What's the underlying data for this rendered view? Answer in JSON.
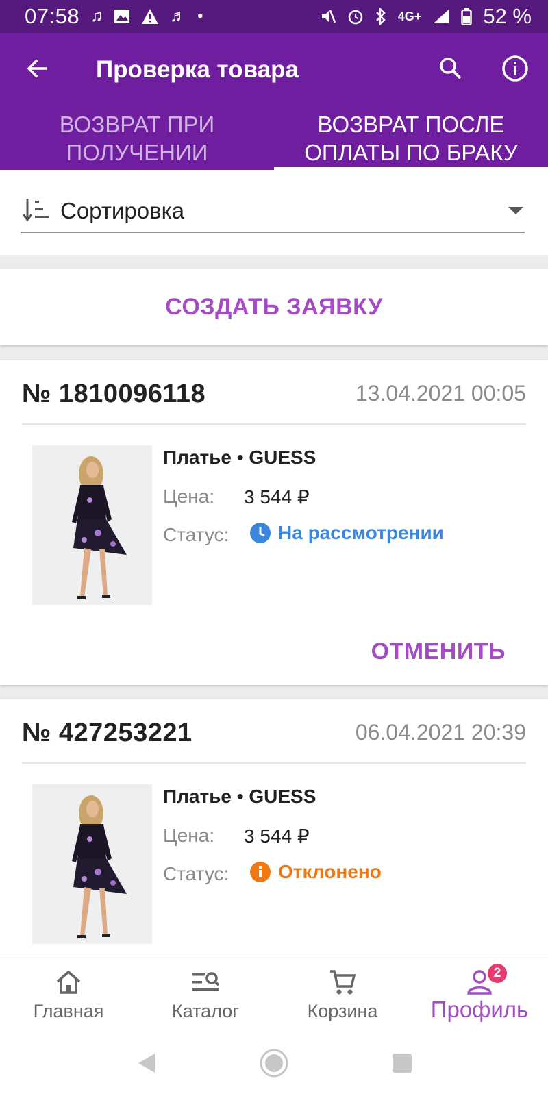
{
  "status_bar": {
    "time": "07:58",
    "network": "4G+",
    "battery": "52 %"
  },
  "toolbar": {
    "title": "Проверка товара",
    "back_icon": "arrow-left-icon",
    "search_icon": "search-icon",
    "info_icon": "info-icon"
  },
  "tabs": [
    {
      "label": "Возврат при получении",
      "active": false
    },
    {
      "label": "Возврат после оплаты по браку",
      "active": true
    }
  ],
  "sort": {
    "label": "Сортировка",
    "icon": "sort-icon"
  },
  "create_request": {
    "label": "СОЗДАТЬ ЗАЯВКУ"
  },
  "labels": {
    "price": "Цена:",
    "status": "Статус:"
  },
  "orders": [
    {
      "number": "№ 1810096118",
      "date": "13.04.2021 00:05",
      "item": "Платье • GUESS",
      "price": "3 544 ₽",
      "status": "На рассмотрении",
      "status_color": "#3b87e0",
      "status_icon": "clock-icon",
      "action": "ОТМЕНИТЬ"
    },
    {
      "number": "№ 427253221",
      "date": "06.04.2021 20:39",
      "item": "Платье • GUESS",
      "price": "3 544 ₽",
      "status": "Отклонено",
      "status_color": "#f07812",
      "status_icon": "info-circle-icon"
    }
  ],
  "bottom_nav": [
    {
      "label": "Главная",
      "icon": "home-icon",
      "active": false
    },
    {
      "label": "Каталог",
      "icon": "catalog-search-icon",
      "active": false
    },
    {
      "label": "Корзина",
      "icon": "cart-icon",
      "active": false
    },
    {
      "label": "Профиль",
      "icon": "profile-icon",
      "active": true,
      "badge": "2"
    }
  ],
  "colors": {
    "primary": "#701ea0",
    "status_bar": "#561a7f",
    "accent": "#a64bc6"
  }
}
